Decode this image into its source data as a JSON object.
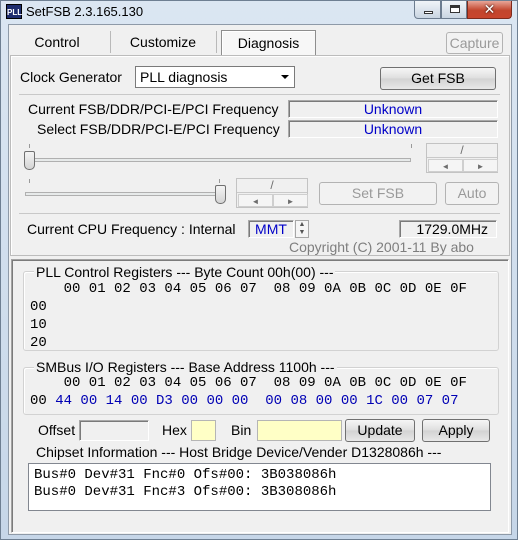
{
  "window": {
    "icon_text": "PLL",
    "title": "SetFSB 2.3.165.130",
    "close_glyph": "✕"
  },
  "tabs": [
    {
      "label": "Control"
    },
    {
      "label": "Customize"
    },
    {
      "label": "Diagnosis"
    }
  ],
  "capture_label": "Capture",
  "clock": {
    "label": "Clock Generator",
    "selected": "PLL diagnosis",
    "get_fsb_label": "Get FSB",
    "current_freq_label": "Current FSB/DDR/PCI-E/PCI Frequency",
    "current_freq_value": "Unknown",
    "select_freq_label": "Select FSB/DDR/PCI-E/PCI Frequency",
    "select_freq_value": "Unknown"
  },
  "spinners": {
    "top": {
      "value": "/",
      "left": "◄",
      "right": "►"
    },
    "bottom": {
      "value": "/",
      "left": "◄",
      "right": "►"
    }
  },
  "set_fsb_label": "Set FSB",
  "auto_label": "Auto",
  "cpu": {
    "label": "Current CPU Frequency : Internal",
    "mode": "MMT",
    "spin_up": "▲",
    "spin_down": "▼",
    "value": "1729.0MHz"
  },
  "copyright": "Copyright (C) 2001-11 By abo",
  "pll": {
    "title": "PLL Control Registers  --- Byte Count 00h(00) ---",
    "header": "    00 01 02 03 04 05 06 07  08 09 0A 0B 0C 0D 0E 0F",
    "rows": [
      "00",
      "10",
      "20"
    ]
  },
  "smbus": {
    "title": "SMBus I/O Registers  --- Base Address 1100h ---",
    "header": "    00 01 02 03 04 05 06 07  08 09 0A 0B 0C 0D 0E 0F",
    "row_label": "00",
    "row_values": " 44 00 14 00 D3 00 00 00  00 08 00 00 1C 00 07 07"
  },
  "edit": {
    "offset_label": "Offset",
    "hex_label": "Hex",
    "bin_label": "Bin",
    "update_label": "Update",
    "apply_label": "Apply"
  },
  "chipset": {
    "title": "Chipset Information  --- Host Bridge Device/Vender D1328086h ---",
    "lines": [
      "Bus#0 Dev#31 Fnc#0 Ofs#00: 3B038086h",
      "Bus#0 Dev#31 Fnc#3 Ofs#00: 3B308086h"
    ]
  }
}
